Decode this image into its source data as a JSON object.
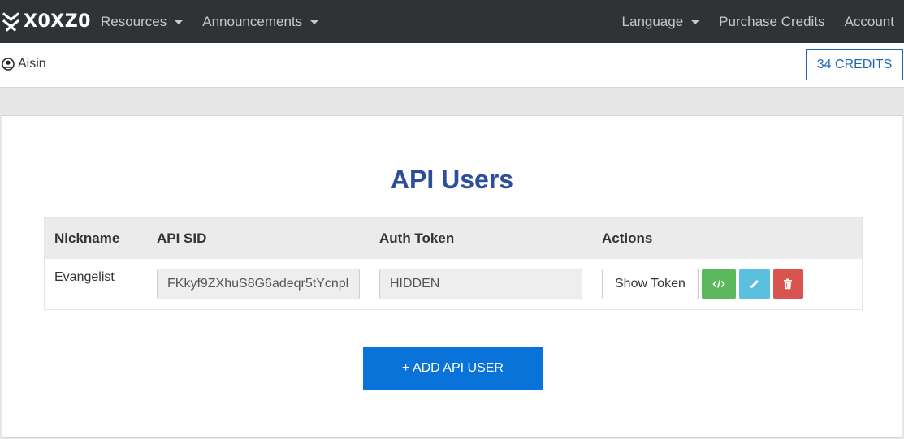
{
  "brand": {
    "name": "X0XZ0"
  },
  "nav": {
    "left": [
      {
        "label": "Resources"
      },
      {
        "label": "Announcements"
      }
    ],
    "right": [
      {
        "label": "Language"
      },
      {
        "label": "Purchase Credits"
      },
      {
        "label": "Account"
      }
    ]
  },
  "user": {
    "name": "Aisin"
  },
  "credits": {
    "label": "34 CREDITS"
  },
  "page": {
    "title": "API Users"
  },
  "table": {
    "headers": [
      "Nickname",
      "API SID",
      "Auth Token",
      "Actions"
    ],
    "rows": [
      {
        "nickname": "Evangelist",
        "api_sid": "FKkyf9ZXhuS8G6adeqr5tYcnpl",
        "auth_token": "HIDDEN",
        "show_token_label": "Show Token"
      }
    ]
  },
  "add_button": {
    "label": "+ ADD API USER"
  },
  "colors": {
    "navbar": "#303335",
    "title": "#2b4f9a",
    "primary": "#0a73d9",
    "success": "#5cb85c",
    "info": "#5bc0de",
    "danger": "#d9534f"
  }
}
